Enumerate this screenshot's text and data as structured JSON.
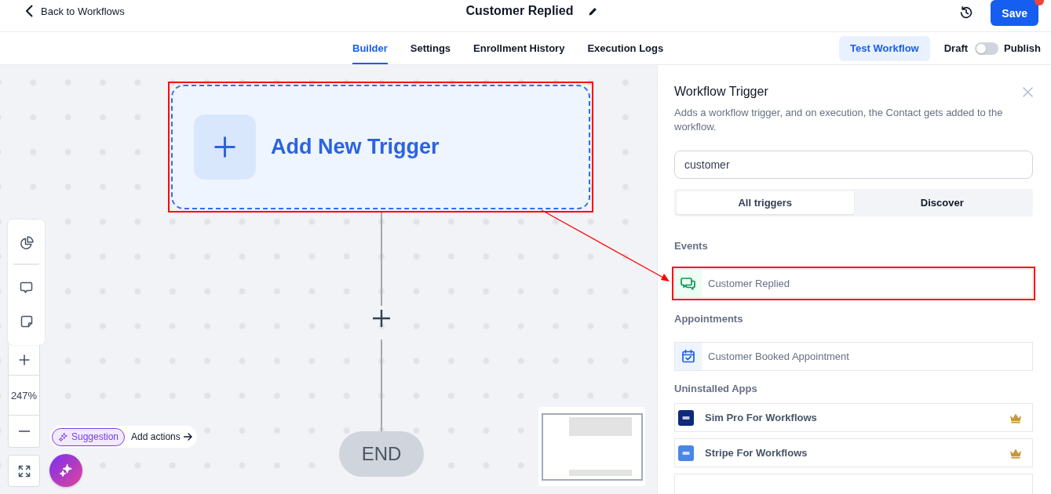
{
  "header": {
    "back_link": "Back to Workflows",
    "title": "Customer Replied",
    "save_button": "Save",
    "save_notification": true
  },
  "tabs": [
    {
      "label": "Builder",
      "selected": true
    },
    {
      "label": "Settings",
      "selected": false
    },
    {
      "label": "Enrollment History",
      "selected": false
    },
    {
      "label": "Execution Logs",
      "selected": false
    }
  ],
  "toolbar": {
    "test_button": "Test Workflow",
    "status_toggle": {
      "off_label": "Draft",
      "on_label": "Publish",
      "on": false
    }
  },
  "canvas": {
    "trigger_node": {
      "label": "Add New Trigger",
      "highlighted": true
    },
    "end_node": {
      "label": "END"
    },
    "zoom_level": "247%",
    "suggestion": {
      "badge": "Suggestion",
      "action": "Add actions"
    }
  },
  "panel": {
    "title": "Workflow Trigger",
    "description": "Adds a workflow trigger, and on execution, the Contact gets added to the workflow.",
    "search": {
      "value": "customer"
    },
    "segments": [
      {
        "label": "All triggers",
        "selected": true
      },
      {
        "label": "Discover",
        "selected": false
      }
    ],
    "sections": [
      {
        "heading": "Events",
        "items": [
          {
            "kind": "event",
            "label": "Customer Replied",
            "highlighted": true
          }
        ]
      },
      {
        "heading": "Appointments",
        "items": [
          {
            "kind": "appointment",
            "label": "Customer Booked Appointment",
            "highlighted": false
          }
        ]
      },
      {
        "heading": "Uninstalled Apps",
        "items": [
          {
            "kind": "app",
            "label": "Sim Pro For Workflows",
            "color": "#0e2a78",
            "premium": true,
            "highlighted": false
          },
          {
            "kind": "app",
            "label": "Stripe For Workflows",
            "color": "#4a86e8",
            "premium": true,
            "highlighted": false
          }
        ]
      }
    ]
  }
}
